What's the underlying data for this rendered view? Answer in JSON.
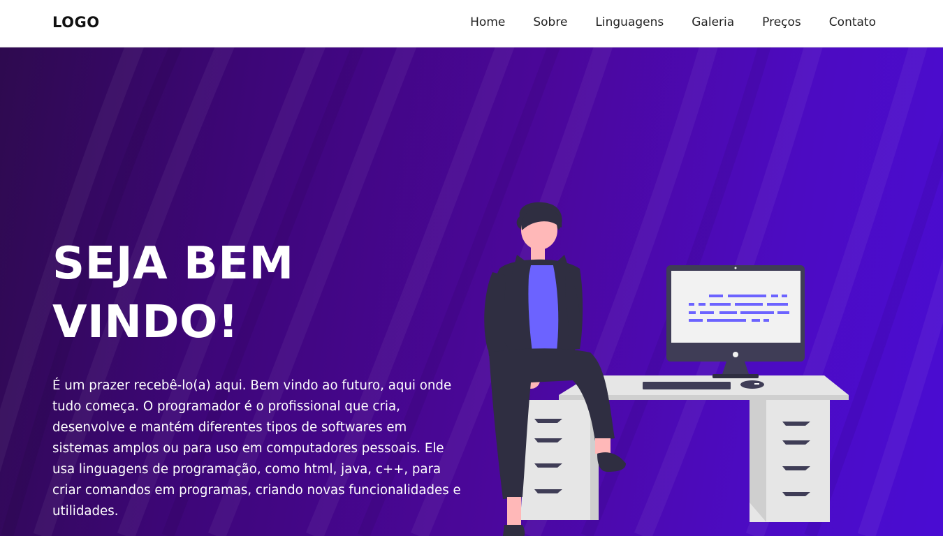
{
  "header": {
    "logo": "LOGO",
    "nav": [
      {
        "label": "Home"
      },
      {
        "label": "Sobre"
      },
      {
        "label": "Linguagens"
      },
      {
        "label": "Galeria"
      },
      {
        "label": "Preços"
      },
      {
        "label": "Contato"
      }
    ]
  },
  "hero": {
    "title_line1": "SEJA BEM",
    "title_line2": "VINDO!",
    "description": "É um prazer recebê-lo(a) aqui. Bem vindo ao futuro, aqui onde tudo começa. O programador é o profissional que cria, desenvolve e mantém diferentes tipos de softwares em sistemas amplos ou para uso em computadores pessoais. Ele usa linguagens de programação, como html, java, c++, para criar comandos em programas, criando novas funcionalidades e utilidades."
  },
  "illustration": {
    "name": "programmer-at-desk-illustration",
    "colors": {
      "accent": "#6c63ff",
      "dark": "#2f2e41",
      "desk": "#e6e6e6",
      "skin": "#ffb8b8",
      "screen": "#f2f2f2"
    }
  },
  "colors": {
    "hero_gradient_start": "#2e0a4f",
    "hero_gradient_end": "#4a0cd3",
    "nav_text": "#222222",
    "hero_text": "#ffffff"
  }
}
